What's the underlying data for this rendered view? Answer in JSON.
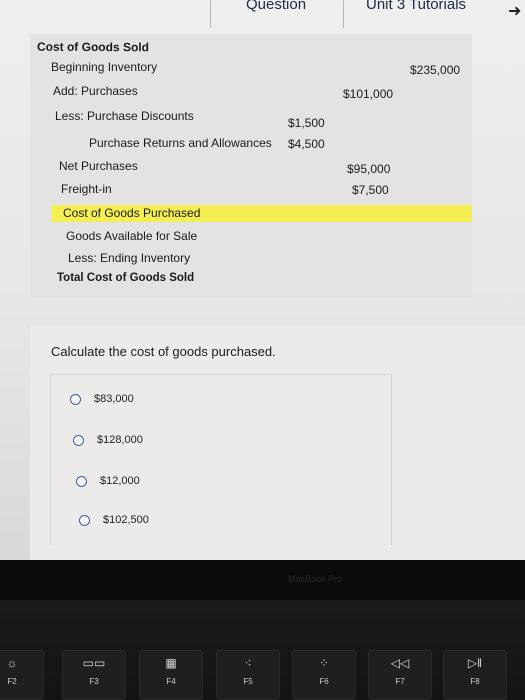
{
  "tabs": {
    "question": "Question",
    "unit": "Unit 3 Tutorials"
  },
  "cogs": {
    "title": "Cost of Goods Sold",
    "beginning_inventory": {
      "label": "Beginning Inventory",
      "amount": "$235,000"
    },
    "purchases": {
      "label": "Add: Purchases",
      "amount": "$101,000"
    },
    "purchase_discounts": {
      "label": "Less: Purchase Discounts",
      "amount": "$1,500"
    },
    "purchase_returns": {
      "label": "Purchase Returns and Allowances",
      "amount": "$4,500"
    },
    "net_purchases": {
      "label": "Net Purchases",
      "amount": "$95,000"
    },
    "freight_in": {
      "label": "Freight-in",
      "amount": "$7,500"
    },
    "cost_of_goods_purchased": {
      "label": "Cost of Goods Purchased"
    },
    "goods_available": {
      "label": "Goods Available for Sale"
    },
    "ending_inventory": {
      "label": "Less: Ending Inventory"
    },
    "total_cogs": {
      "label": "Total Cost of Goods Sold"
    }
  },
  "question": {
    "prompt": "Calculate the cost of goods purchased.",
    "choices": [
      "$83,000",
      "$128,000",
      "$12,000",
      "$102,500"
    ]
  },
  "device": {
    "brand": "MacBook Pro"
  },
  "keys": [
    {
      "label": "F2",
      "icon": "brightness-up-icon",
      "glyph": "☼"
    },
    {
      "label": "F3",
      "icon": "mission-control-icon",
      "glyph": "▭▭"
    },
    {
      "label": "F4",
      "icon": "launchpad-icon",
      "glyph": "▦"
    },
    {
      "label": "F5",
      "icon": "keyboard-light-down-icon",
      "glyph": "⁖"
    },
    {
      "label": "F6",
      "icon": "keyboard-light-up-icon",
      "glyph": "⁘"
    },
    {
      "label": "F7",
      "icon": "rewind-icon",
      "glyph": "◁◁"
    },
    {
      "label": "F8",
      "icon": "play-pause-icon",
      "glyph": "▷‖"
    }
  ]
}
